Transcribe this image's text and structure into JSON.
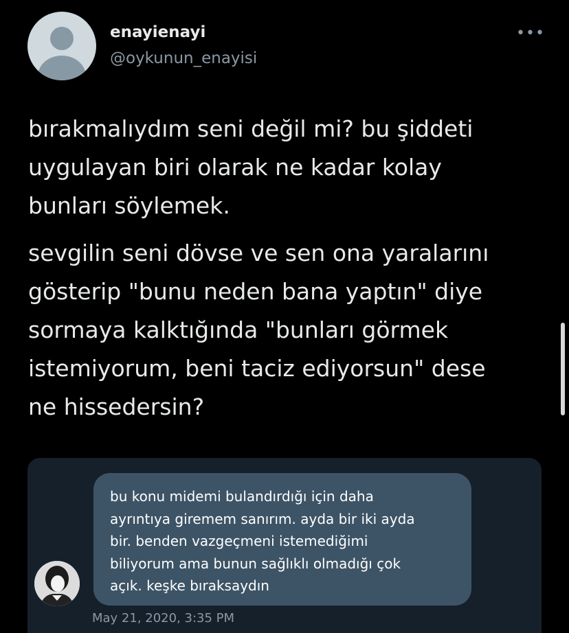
{
  "user": {
    "display_name": "enayienayi",
    "handle": "@oykunun_enayisi",
    "avatar_icon": "default-profile-avatar"
  },
  "menu": {
    "more_icon_glyph": "•••"
  },
  "tweet": {
    "paragraph1": [
      "bırakmalıydım seni değil mi? bu şiddeti",
      "uygulayan biri olarak ne kadar kolay",
      "bunları söylemek."
    ],
    "paragraph2": [
      "sevgilin seni dövse ve sen ona yaralarını",
      "gösterip \"bunu neden bana yaptın\" diye",
      "sormaya kalktığında \"bunları görmek",
      "istemiyorum, beni taciz ediyorsun\" dese",
      "ne hissedersin?"
    ]
  },
  "screenshot": {
    "message_lines": [
      "bu konu midemi bulandırdığı için daha",
      "ayrıntıya giremem sanırım. ayda bir iki ayda",
      "bir. benden vazgeçmeni istemediğimi",
      "biliyorum ama bunun sağlıklı olmadığı çok",
      "açık. keşke bıraksaydın"
    ],
    "timestamp": "May 21, 2020, 3:35 PM",
    "sender_avatar_icon": "sender-portrait"
  },
  "colors": {
    "background": "#000000",
    "text_primary": "#e7e9ea",
    "text_secondary": "#8b98a5",
    "embed_background": "#15202b",
    "bubble": "#3d5466"
  }
}
